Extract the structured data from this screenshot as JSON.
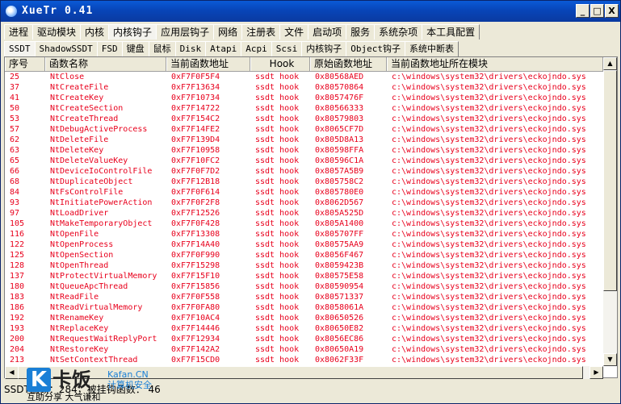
{
  "window": {
    "title": "XueTr 0.41",
    "controls": {
      "minimize": "_",
      "maximize": "□",
      "close": "X"
    }
  },
  "main_tabs": [
    {
      "label": "进程",
      "active": false
    },
    {
      "label": "驱动模块",
      "active": false
    },
    {
      "label": "内核",
      "active": false
    },
    {
      "label": "内核钩子",
      "active": true
    },
    {
      "label": "应用层钩子",
      "active": false
    },
    {
      "label": "网络",
      "active": false
    },
    {
      "label": "注册表",
      "active": false
    },
    {
      "label": "文件",
      "active": false
    },
    {
      "label": "启动项",
      "active": false
    },
    {
      "label": "服务",
      "active": false
    },
    {
      "label": "系统杂项",
      "active": false
    },
    {
      "label": "本工具配置",
      "active": false
    }
  ],
  "sub_tabs": [
    {
      "label": "SSDT",
      "active": true
    },
    {
      "label": "ShadowSSDT",
      "active": false
    },
    {
      "label": "FSD",
      "active": false
    },
    {
      "label": "键盘",
      "active": false
    },
    {
      "label": "鼠标",
      "active": false
    },
    {
      "label": "Disk",
      "active": false
    },
    {
      "label": "Atapi",
      "active": false
    },
    {
      "label": "Acpi",
      "active": false
    },
    {
      "label": "Scsi",
      "active": false
    },
    {
      "label": "内核钩子",
      "active": false
    },
    {
      "label": "Object钩子",
      "active": false
    },
    {
      "label": "系统中断表",
      "active": false
    }
  ],
  "table": {
    "columns": [
      "序号",
      "函数名称",
      "当前函数地址",
      "Hook",
      "原始函数地址",
      "当前函数地址所在模块"
    ],
    "rows": [
      [
        "25",
        "NtClose",
        "0xF7F0F5F4",
        "ssdt hook",
        "0x80568AED",
        "c:\\windows\\system32\\drivers\\eckojndo.sys"
      ],
      [
        "37",
        "NtCreateFile",
        "0xF7F13634",
        "ssdt hook",
        "0x80570864",
        "c:\\windows\\system32\\drivers\\eckojndo.sys"
      ],
      [
        "41",
        "NtCreateKey",
        "0xF7F10734",
        "ssdt hook",
        "0x8057476F",
        "c:\\windows\\system32\\drivers\\eckojndo.sys"
      ],
      [
        "50",
        "NtCreateSection",
        "0xF7F14722",
        "ssdt hook",
        "0x80566333",
        "c:\\windows\\system32\\drivers\\eckojndo.sys"
      ],
      [
        "53",
        "NtCreateThread",
        "0xF7F154C2",
        "ssdt hook",
        "0x80579803",
        "c:\\windows\\system32\\drivers\\eckojndo.sys"
      ],
      [
        "57",
        "NtDebugActiveProcess",
        "0xF7F14FE2",
        "ssdt hook",
        "0x8065CF7D",
        "c:\\windows\\system32\\drivers\\eckojndo.sys"
      ],
      [
        "62",
        "NtDeleteFile",
        "0xF7F139D4",
        "ssdt hook",
        "0x805D8A13",
        "c:\\windows\\system32\\drivers\\eckojndo.sys"
      ],
      [
        "63",
        "NtDeleteKey",
        "0xF7F10958",
        "ssdt hook",
        "0x80598FFA",
        "c:\\windows\\system32\\drivers\\eckojndo.sys"
      ],
      [
        "65",
        "NtDeleteValueKey",
        "0xF7F10FC2",
        "ssdt hook",
        "0x80596C1A",
        "c:\\windows\\system32\\drivers\\eckojndo.sys"
      ],
      [
        "66",
        "NtDeviceIoControlFile",
        "0xF7F0F7D2",
        "ssdt hook",
        "0x8057A5B9",
        "c:\\windows\\system32\\drivers\\eckojndo.sys"
      ],
      [
        "68",
        "NtDuplicateObject",
        "0xF7F12B18",
        "ssdt hook",
        "0x805758C2",
        "c:\\windows\\system32\\drivers\\eckojndo.sys"
      ],
      [
        "84",
        "NtFsControlFile",
        "0xF7F0F614",
        "ssdt hook",
        "0x805780E0",
        "c:\\windows\\system32\\drivers\\eckojndo.sys"
      ],
      [
        "93",
        "NtInitiatePowerAction",
        "0xF7F0F2F8",
        "ssdt hook",
        "0x8062D567",
        "c:\\windows\\system32\\drivers\\eckojndo.sys"
      ],
      [
        "97",
        "NtLoadDriver",
        "0xF7F12526",
        "ssdt hook",
        "0x805A525D",
        "c:\\windows\\system32\\drivers\\eckojndo.sys"
      ],
      [
        "105",
        "NtMakeTemporaryObject",
        "0xF7F0F428",
        "ssdt hook",
        "0x805A1400",
        "c:\\windows\\system32\\drivers\\eckojndo.sys"
      ],
      [
        "116",
        "NtOpenFile",
        "0xF7F13308",
        "ssdt hook",
        "0x805707FF",
        "c:\\windows\\system32\\drivers\\eckojndo.sys"
      ],
      [
        "122",
        "NtOpenProcess",
        "0xF7F14A40",
        "ssdt hook",
        "0x80575AA9",
        "c:\\windows\\system32\\drivers\\eckojndo.sys"
      ],
      [
        "125",
        "NtOpenSection",
        "0xF7F0F990",
        "ssdt hook",
        "0x8056F467",
        "c:\\windows\\system32\\drivers\\eckojndo.sys"
      ],
      [
        "128",
        "NtOpenThread",
        "0xF7F15298",
        "ssdt hook",
        "0x8059423B",
        "c:\\windows\\system32\\drivers\\eckojndo.sys"
      ],
      [
        "137",
        "NtProtectVirtualMemory",
        "0xF7F15F10",
        "ssdt hook",
        "0x80575E58",
        "c:\\windows\\system32\\drivers\\eckojndo.sys"
      ],
      [
        "180",
        "NtQueueApcThread",
        "0xF7F15856",
        "ssdt hook",
        "0x80590954",
        "c:\\windows\\system32\\drivers\\eckojndo.sys"
      ],
      [
        "183",
        "NtReadFile",
        "0xF7F0F558",
        "ssdt hook",
        "0x80571337",
        "c:\\windows\\system32\\drivers\\eckojndo.sys"
      ],
      [
        "186",
        "NtReadVirtualMemory",
        "0xF7F0FA80",
        "ssdt hook",
        "0x8058061A",
        "c:\\windows\\system32\\drivers\\eckojndo.sys"
      ],
      [
        "192",
        "NtRenameKey",
        "0xF7F10AC4",
        "ssdt hook",
        "0x80650526",
        "c:\\windows\\system32\\drivers\\eckojndo.sys"
      ],
      [
        "193",
        "NtReplaceKey",
        "0xF7F14446",
        "ssdt hook",
        "0x80650E82",
        "c:\\windows\\system32\\drivers\\eckojndo.sys"
      ],
      [
        "200",
        "NtRequestWaitReplyPort",
        "0xF7F12934",
        "ssdt hook",
        "0x8056EC86",
        "c:\\windows\\system32\\drivers\\eckojndo.sys"
      ],
      [
        "204",
        "NtRestoreKey",
        "0xF7F142A2",
        "ssdt hook",
        "0x80650A19",
        "c:\\windows\\system32\\drivers\\eckojndo.sys"
      ],
      [
        "213",
        "NtSetContextThread",
        "0xF7F15CD0",
        "ssdt hook",
        "0x8062F33F",
        "c:\\windows\\system32\\drivers\\eckojndo.sys"
      ]
    ]
  },
  "status": {
    "text": "SSDT函数：284，被挂钩函数：  46"
  },
  "watermark": {
    "glyph": "K",
    "name": "卡饭",
    "site": "Kafan.CN",
    "sub": "计算机安全",
    "bottom": "互助分享  大气谦和"
  },
  "colors": {
    "title_bar": "#0845b8",
    "row_text": "#e8001c",
    "face": "#ece9d8"
  }
}
